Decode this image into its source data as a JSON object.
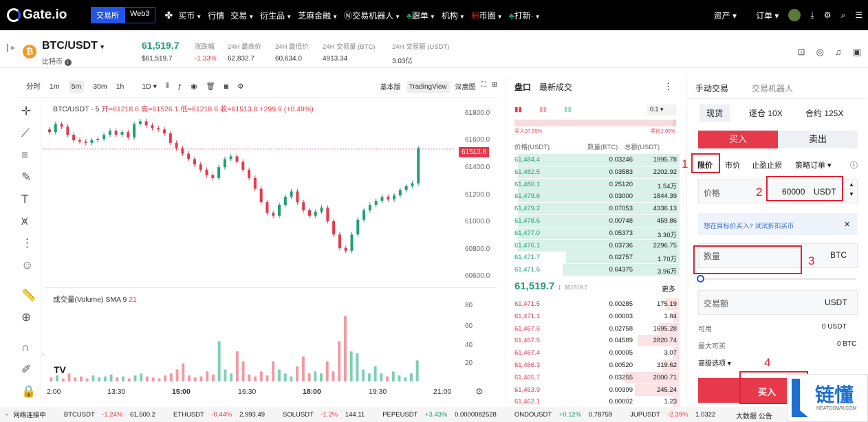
{
  "topnav": {
    "logo": "Gate.io",
    "toggle": [
      "交易所",
      "Web3"
    ],
    "menu": [
      "买币",
      "行情",
      "交易",
      "衍生品",
      "芝麻金融",
      "交易机器人",
      "跟单",
      "机构",
      "币圈",
      "打新·"
    ],
    "right": [
      "资产",
      "订单"
    ]
  },
  "ticker": {
    "pair": "BTC/USDT",
    "coin_name": "比特币",
    "price": "61,519.7",
    "price_sub": "$61,519.7",
    "stats": [
      {
        "label": "涨跌幅",
        "value": "-1.33%"
      },
      {
        "label": "24H 最高价",
        "value": "62,832.7"
      },
      {
        "label": "24H 最低价",
        "value": "60,634.0"
      },
      {
        "label": "24H 交易量 (BTC)",
        "value": "4913.34"
      },
      {
        "label": "24H 交易额 (USDT)",
        "value": "3.03亿"
      }
    ]
  },
  "chart_toolbar": {
    "intervals": [
      "分时",
      "1m",
      "5m",
      "30m",
      "1h",
      "1D"
    ],
    "selected": "5m",
    "views": [
      "基本版",
      "TradingView",
      "深度图"
    ],
    "selected_view": "TradingView"
  },
  "chart": {
    "legend": "BTC/USDT · 5",
    "ohlc": "开=61218.6 高=61526.1 低=61218.6 收=61513.8 +299.9 (+0.49%)",
    "price_tag": "61513.8",
    "y_ticks": [
      "61800.0",
      "61600.0",
      "61400.0",
      "61200.0",
      "61000.0",
      "60800.0",
      "60600.0"
    ],
    "volume_label": "成交量(Volume) SMA 9",
    "volume_value": "21",
    "volume_ticks": [
      "80",
      "60",
      "40",
      "20"
    ],
    "x_ticks": [
      "2:00",
      "13:30",
      "15:00",
      "16:30",
      "18:00",
      "19:30",
      "21:00"
    ]
  },
  "chart_data": {
    "type": "candlestick",
    "series": [
      {
        "name": "Price",
        "values": [
          61640,
          61700,
          61680,
          61620,
          61580,
          61570,
          61560,
          61580,
          61590,
          61620,
          61650,
          61620,
          61640,
          61600,
          61700,
          61720,
          61690,
          61670,
          61660,
          61630,
          61560,
          61520,
          61480,
          61440,
          61400,
          61360,
          61320,
          61300,
          61380,
          61440,
          61460,
          61420,
          61360,
          61300,
          61220,
          61120,
          61040,
          61020,
          61100,
          61160,
          61200,
          61120,
          61060,
          61020,
          61050,
          61080,
          60980,
          60880,
          60780,
          60760,
          60880,
          60990,
          61060,
          61100,
          61130,
          61160,
          61140,
          61170,
          61210,
          61240,
          61260,
          61520
        ]
      },
      {
        "name": "Volume",
        "values": [
          4,
          6,
          3,
          8,
          4,
          5,
          3,
          6,
          4,
          5,
          7,
          4,
          5,
          3,
          6,
          8,
          5,
          4,
          3,
          6,
          8,
          12,
          18,
          6,
          4,
          5,
          10,
          7,
          40,
          12,
          8,
          30,
          20,
          7,
          5,
          10,
          6,
          20,
          12,
          8,
          5,
          15,
          25,
          8,
          10,
          8,
          20,
          10,
          40,
          65,
          30,
          28,
          12,
          8,
          15,
          8,
          5,
          10,
          6,
          4,
          8,
          21
        ]
      }
    ],
    "ylim": [
      60550,
      61850
    ]
  },
  "orderbook": {
    "tabs": [
      "盘口",
      "最新成交"
    ],
    "precision": "0.1",
    "ratio_buy": "买入97.95%",
    "ratio_sell": "卖出2.05%",
    "columns": [
      "价格(USDT)",
      "数量(BTC)",
      "总额(USDT)"
    ],
    "bids": [
      {
        "price": "61,484.4",
        "amount": "0.03246",
        "total": "1995.78"
      },
      {
        "price": "61,482.5",
        "amount": "0.03583",
        "total": "2202.92"
      },
      {
        "price": "61,480.1",
        "amount": "0.25120",
        "total": "1.54万"
      },
      {
        "price": "61,479.6",
        "amount": "0.03000",
        "total": "1844.39"
      },
      {
        "price": "61,479.2",
        "amount": "0.07053",
        "total": "4336.13"
      },
      {
        "price": "61,478.6",
        "amount": "0.00748",
        "total": "459.86"
      },
      {
        "price": "61,477.0",
        "amount": "0.05373",
        "total": "3.30万"
      },
      {
        "price": "61,476.1",
        "amount": "0.03736",
        "total": "2296.75"
      },
      {
        "price": "61,471.7",
        "amount": "0.02757",
        "total": "1.70万"
      },
      {
        "price": "61,471.6",
        "amount": "0.64375",
        "total": "3.96万"
      }
    ],
    "mid_price": "61,519.7",
    "mid_sub": "$61519.7",
    "more": "更多",
    "asks": [
      {
        "price": "61,471.5",
        "amount": "0.00285",
        "total": "175.19"
      },
      {
        "price": "61,471.1",
        "amount": "0.00003",
        "total": "1.84"
      },
      {
        "price": "61,467.6",
        "amount": "0.02758",
        "total": "1695.28"
      },
      {
        "price": "61,467.5",
        "amount": "0.04589",
        "total": "2820.74"
      },
      {
        "price": "61,467.4",
        "amount": "0.00005",
        "total": "3.07"
      },
      {
        "price": "61,466.3",
        "amount": "0.00520",
        "total": "319.62"
      },
      {
        "price": "61,465.7",
        "amount": "0.03255",
        "total": "2000.71"
      },
      {
        "price": "61,463.9",
        "amount": "0.00399",
        "total": "245.24"
      },
      {
        "price": "61,462.1",
        "amount": "0.00002",
        "total": "1.23"
      }
    ]
  },
  "trade_panel": {
    "tabs": [
      "手动交易",
      "交易机器人"
    ],
    "modes": [
      "现货",
      "逐仓 10X",
      "合约 125X"
    ],
    "buy": "买入",
    "sell": "卖出",
    "order_types": [
      "限价",
      "市价",
      "止盈止损",
      "策略订单"
    ],
    "price_label": "价格",
    "price_value": "60000",
    "price_unit": "USDT",
    "hint": "想在目标价买入? 试试折扣买币",
    "qty_label": "数量",
    "qty_unit": "BTC",
    "amount_label": "交易额",
    "amount_unit": "USDT",
    "avail_label": "可用",
    "avail_value": "0 USDT",
    "max_label": "最大可买",
    "max_value": "0 BTC",
    "advanced": "高级选项",
    "submit": "买入",
    "annotations": [
      "1",
      "2",
      "3",
      "4"
    ]
  },
  "statusbar": {
    "net": "网络连接中",
    "tickers": [
      {
        "sym": "BTCUSDT",
        "chg": "-1.24%",
        "px": "61,500.2",
        "up": false
      },
      {
        "sym": "ETHUSDT",
        "chg": "-0.44%",
        "px": "2,993.49",
        "up": false
      },
      {
        "sym": "SOLUSDT",
        "chg": "-1.2%",
        "px": "144.11",
        "up": false
      },
      {
        "sym": "PEPEUSDT",
        "chg": "+3.43%",
        "px": "0.0000082528",
        "up": true
      },
      {
        "sym": "ONDOUSDT",
        "chg": "+0.12%",
        "px": "0.78759",
        "up": true
      },
      {
        "sym": "JUPUSDT",
        "chg": "-2.39%",
        "px": "1.0322",
        "up": false
      }
    ],
    "right": "大数据 公告"
  },
  "watermark": {
    "text": "链懂",
    "url": "NEATDOWN.COM"
  }
}
